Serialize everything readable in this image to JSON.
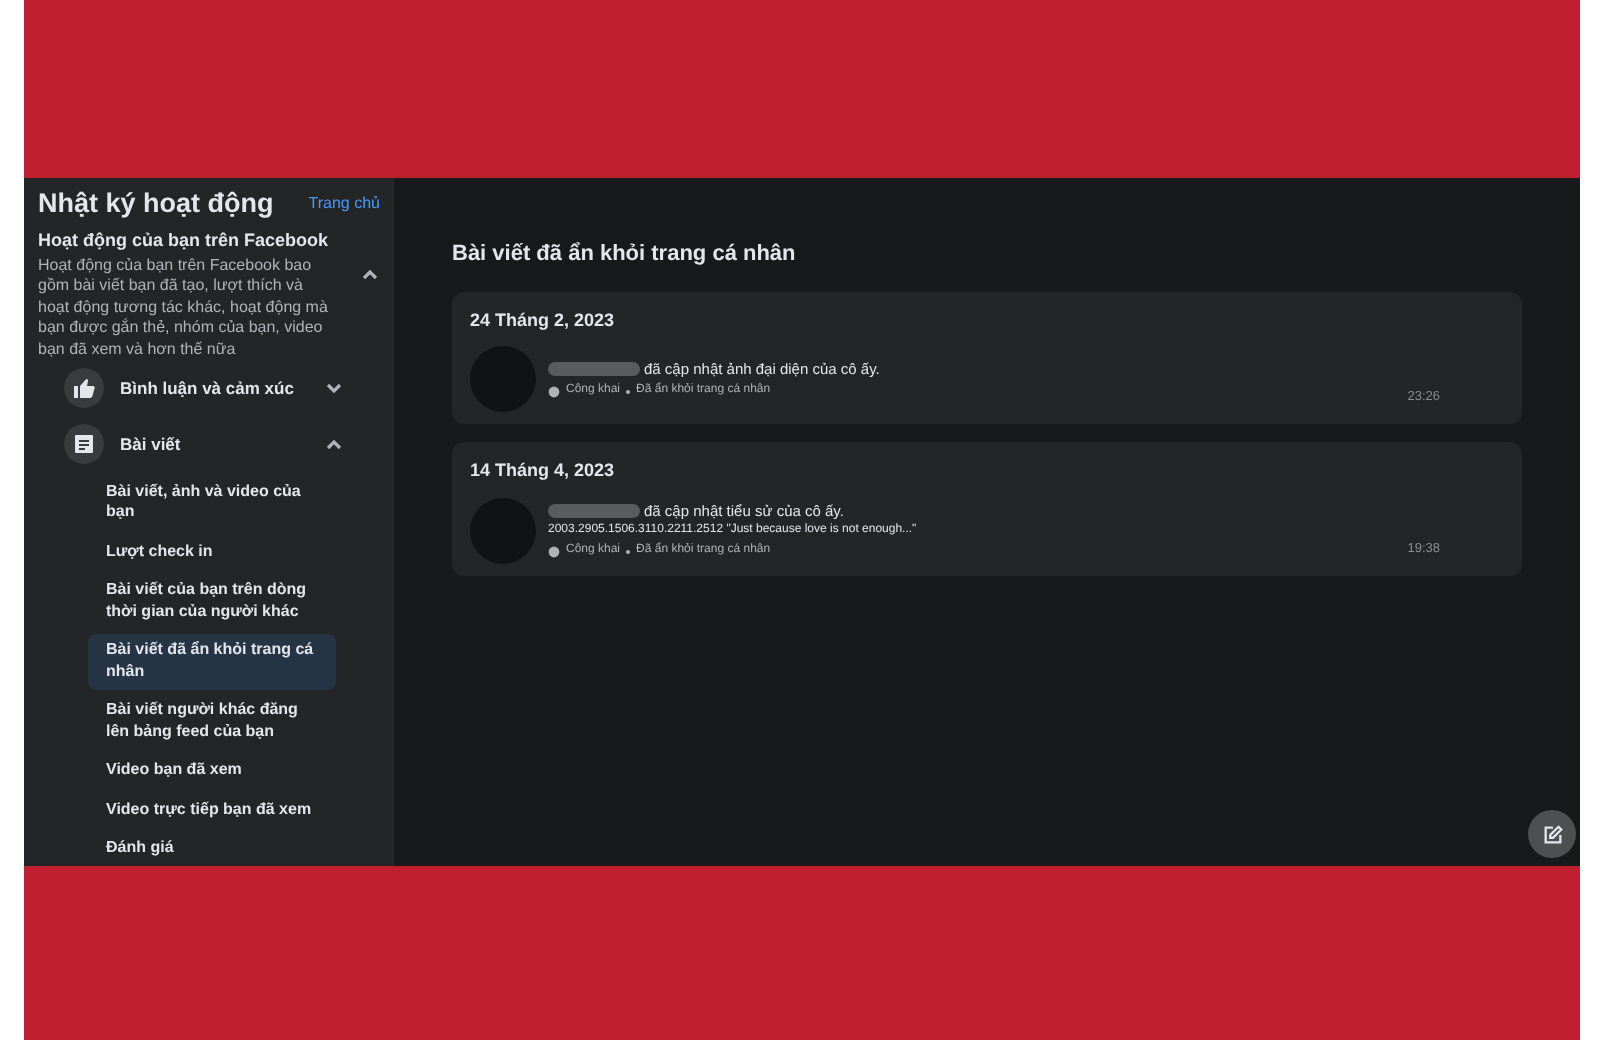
{
  "sidebar": {
    "title": "Nhật ký hoạt động",
    "home_link": "Trang chủ",
    "section": {
      "title": "Hoạt động của bạn trên Facebook",
      "description": "Hoạt động của bạn trên Facebook bao gồm bài viết bạn đã tạo, lượt thích và hoạt động tương tác khác, hoạt động mà bạn được gắn thẻ, nhóm của bạn, video bạn đã xem và hơn thế nữa",
      "expanded": true
    },
    "categories": [
      {
        "label": "Bình luận và cảm xúc",
        "kind": "like",
        "expanded": false
      },
      {
        "label": "Bài viết",
        "kind": "post",
        "expanded": true,
        "children": [
          {
            "label": "Bài viết, ảnh và video của bạn",
            "selected": false
          },
          {
            "label": "Lượt check in",
            "selected": false
          },
          {
            "label": "Bài viết của bạn trên dòng thời gian của người khác",
            "selected": false
          },
          {
            "label": "Bài viết đã ẩn khỏi trang cá nhân",
            "selected": true
          },
          {
            "label": "Bài viết người khác đăng lên bảng feed của bạn",
            "selected": false
          },
          {
            "label": "Video bạn đã xem",
            "selected": false
          },
          {
            "label": "Video trực tiếp bạn đã xem",
            "selected": false
          },
          {
            "label": "Đánh giá",
            "selected": false
          }
        ]
      }
    ]
  },
  "main": {
    "title": "Bài viết đã ẩn khỏi trang cá nhân",
    "entries": [
      {
        "date": "24 Tháng 2, 2023",
        "action": "đã cập nhật ảnh đại diện của cô ấy.",
        "privacy": "Công khai",
        "status": "Đã ẩn khỏi trang cá nhân",
        "time": "23:26"
      },
      {
        "date": "14 Tháng 4, 2023",
        "action": "đã cập nhật tiểu sử của cô ấy.",
        "detail": "2003.2905.1506.3110.2211.2512 \"Just because love is not enough...\"",
        "privacy": "Công khai",
        "status": "Đã ẩn khỏi trang cá nhân",
        "time": "19:38"
      }
    ]
  }
}
